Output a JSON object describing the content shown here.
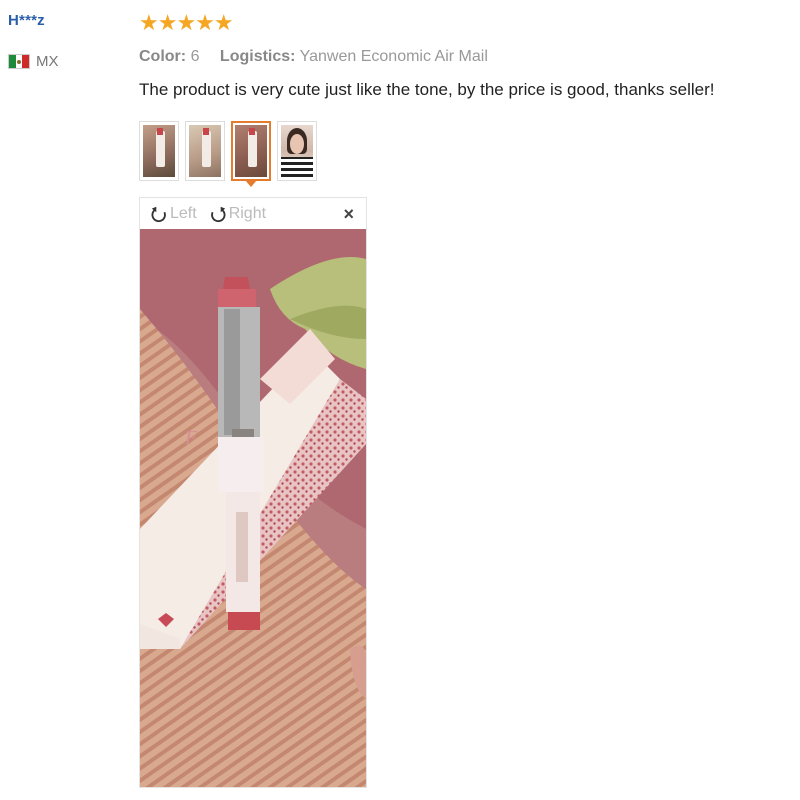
{
  "reviewer": {
    "name": "H***z",
    "country": "MX"
  },
  "review": {
    "stars": "★★★★★",
    "rating": 5,
    "color_label": "Color:",
    "color_value": "6",
    "logistics_label": "Logistics:",
    "logistics_value": "Yanwen Economic Air Mail",
    "text": "The product is very cute just like the tone, by the price is good, thanks seller!"
  },
  "thumbnails": [
    {
      "name": "photo-1",
      "active": false
    },
    {
      "name": "photo-2",
      "active": false
    },
    {
      "name": "photo-3",
      "active": true
    },
    {
      "name": "photo-4",
      "active": false
    }
  ],
  "viewer": {
    "rotate_left_label": "Left",
    "rotate_right_label": "Right",
    "close_label": "×",
    "rotate_left_icon": "rotate-left-icon",
    "rotate_right_icon": "rotate-right-icon"
  },
  "colors": {
    "username": "#2a5fa8",
    "stars": "#f5a623",
    "active_thumb_border": "#e57b2c"
  }
}
